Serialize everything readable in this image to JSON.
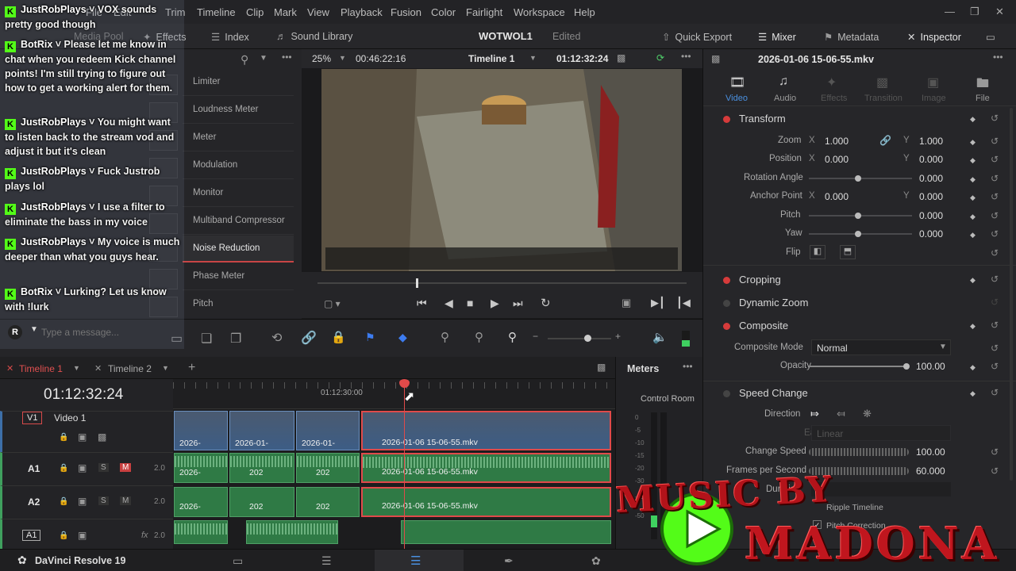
{
  "app": {
    "title": "DaVinci Resolve 19",
    "menus": [
      "File",
      "Edit",
      "Trim",
      "Timeline",
      "Clip",
      "Mark",
      "View",
      "Playback",
      "Fusion",
      "Color",
      "Fairlight",
      "Workspace",
      "Help"
    ]
  },
  "toolbar": {
    "media_pool": "Media Pool",
    "effects": "Effects",
    "index": "Index",
    "sound_library": "Sound Library",
    "project_name": "WOTWOL1",
    "project_status": "Edited",
    "quick_export": "Quick Export",
    "mixer": "Mixer",
    "metadata": "Metadata",
    "inspector": "Inspector"
  },
  "effects_panel": {
    "items": [
      "Limiter",
      "Loudness Meter",
      "Meter",
      "Modulation",
      "Monitor",
      "Multiband Compressor",
      "Noise Reduction",
      "Phase Meter",
      "Pitch"
    ],
    "selected": "Noise Reduction"
  },
  "viewer": {
    "zoom": "25%",
    "duration": "00:46:22:16",
    "timeline_name": "Timeline 1",
    "timecode": "01:12:32:24"
  },
  "inspector": {
    "clip_name": "2026-01-06 15-06-55.mkv",
    "tabs": [
      "Video",
      "Audio",
      "Effects",
      "Transition",
      "Image",
      "File"
    ],
    "transform": {
      "title": "Transform",
      "zoom_label": "Zoom",
      "zoom_x": "1.000",
      "zoom_y": "1.000",
      "position_label": "Position",
      "position_x": "0.000",
      "position_y": "0.000",
      "rotation_label": "Rotation Angle",
      "rotation": "0.000",
      "anchor_label": "Anchor Point",
      "anchor_x": "0.000",
      "anchor_y": "0.000",
      "pitch_label": "Pitch",
      "pitch": "0.000",
      "yaw_label": "Yaw",
      "yaw": "0.000",
      "flip_label": "Flip",
      "x": "X",
      "y": "Y"
    },
    "cropping": "Cropping",
    "dynamic_zoom": "Dynamic Zoom",
    "composite": {
      "title": "Composite",
      "mode_label": "Composite Mode",
      "mode": "Normal",
      "opacity_label": "Opacity",
      "opacity": "100.00"
    },
    "speed_change": {
      "title": "Speed Change",
      "direction_label": "Direction",
      "ease_label": "Ease",
      "ease": "Linear",
      "change_speed_label": "Change Speed",
      "change_speed": "100.00",
      "fps_label": "Frames per Second",
      "fps": "60.000",
      "duration_label": "Duration",
      "ripple_label": "Ripple Timeline",
      "pitch_correction_label": "Pitch Correction"
    }
  },
  "timeline": {
    "tabs": [
      "Timeline 1",
      "Timeline 2"
    ],
    "timecode": "01:12:32:24",
    "ruler_mark": "01:12:30:00",
    "tracks": {
      "v1": {
        "id": "V1",
        "name": "Video 1"
      },
      "a1": {
        "id": "A1",
        "level": "2.0",
        "s": "S",
        "m": "M"
      },
      "a2": {
        "id": "A2",
        "level": "2.0",
        "s": "S",
        "m": "M"
      },
      "a3": {
        "id": "A1",
        "level": "2.0",
        "fx": "fx"
      }
    },
    "clips": {
      "v1": [
        "2026-",
        "2026-01-",
        "2026-01-",
        "2026-01-06 15-06-55.mkv"
      ],
      "a1": [
        "2026-",
        "202",
        "202",
        "2026-01-06 15-06-55.mkv"
      ],
      "a2": [
        "2026-",
        "202",
        "202",
        "2026-01-06 15-06-55.mkv"
      ]
    }
  },
  "meters": {
    "title": "Meters",
    "control_room": "Control Room",
    "ticks": [
      "0",
      "-5",
      "-10",
      "-15",
      "-20",
      "-30",
      "-40",
      "-50"
    ]
  },
  "chat": {
    "messages": [
      {
        "user": "JustRobPlays",
        "text": "VOX sounds pretty good though"
      },
      {
        "user": "BotRix",
        "text": "Please let me know in chat when you redeem Kick channel points! I'm still trying to figure out how to get a working alert for them."
      },
      {
        "user": "JustRobPlays",
        "text": "You might want to listen back to the stream vod and adjust it but it's clean"
      },
      {
        "user": "JustRobPlays",
        "text": "Fuck Justrob plays lol"
      },
      {
        "user": "JustRobPlays",
        "text": "I use a filter to eliminate the bass in my voice"
      },
      {
        "user": "JustRobPlays",
        "text": "My voice is much deeper than what you guys hear."
      },
      {
        "user": "BotRix",
        "text": "Lurking? Let us know with !lurk"
      }
    ],
    "input_placeholder": "Type a message...",
    "avatar_letter": "R"
  },
  "overlay": {
    "line1": "MUSIC BY",
    "line2": "MADONA"
  },
  "colors": {
    "accent_red": "#d63b3b",
    "kick_green": "#53fc18",
    "clip_video": "#3d5d85",
    "clip_audio": "#2f7a45"
  }
}
